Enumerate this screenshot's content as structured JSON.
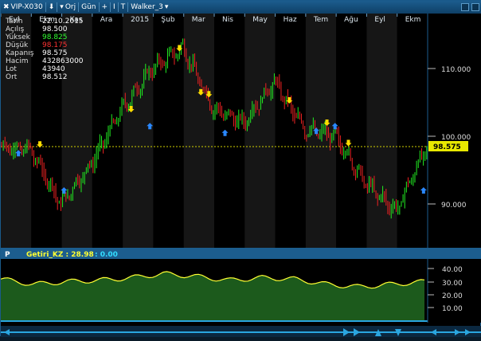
{
  "toolbar": {
    "symbol": "VIP-X030",
    "period_mode": "Orj",
    "interval": "Gün",
    "tool1": "I",
    "tool2": "T",
    "indicator_set": "Walker_3",
    "plus": "+"
  },
  "time_axis": [
    "Eyl",
    "Ekm",
    "Kas",
    "Ara",
    "2015",
    "Şub",
    "Mar",
    "Nis",
    "May",
    "Haz",
    "Tem",
    "Ağu",
    "Eyl",
    "Ekm"
  ],
  "info_panel": [
    {
      "label": "Tarih",
      "value": "22.10.2015",
      "color": "#ffffff"
    },
    {
      "label": "Açılış",
      "value": "98.500",
      "color": "#ffffff"
    },
    {
      "label": "Yüksek",
      "value": "98.825",
      "color": "#33ff33"
    },
    {
      "label": "Düşük",
      "value": "98.175",
      "color": "#ff3333"
    },
    {
      "label": "Kapanış",
      "value": "98.575",
      "color": "#ffffff"
    },
    {
      "label": "Hacim",
      "value": "432863000",
      "color": "#ffffff"
    },
    {
      "label": "Lot",
      "value": "43940",
      "color": "#ffffff"
    },
    {
      "label": "Ort",
      "value": "98.512",
      "color": "#ffffff"
    }
  ],
  "price_axis": {
    "ticks": [
      "110.000",
      "100.000",
      "90.000"
    ],
    "last_price": "98.575"
  },
  "indicator": {
    "pane_label": "P",
    "name": "Getiri_KZ : 28.98",
    "secondary": ": 0.00",
    "ticks": [
      "40.00",
      "30.00",
      "20.00",
      "10.00"
    ]
  },
  "colors": {
    "bull": "#22ee22",
    "bear": "#ee2222",
    "signal_down": "#ffdd00",
    "signal_up": "#2a88ff",
    "line": "#ffff33",
    "fill": "#1c5a1c",
    "accent": "#1c5d8e"
  },
  "chart_data": {
    "type": "line",
    "title": "VIP-X030",
    "price_series": [
      {
        "period": "Eyl",
        "close": 98.0
      },
      {
        "period": "Ekm",
        "close": 90.0
      },
      {
        "period": "Kas",
        "close": 96.0
      },
      {
        "period": "Ara",
        "close": 104.0
      },
      {
        "period": "2015",
        "close": 110.0
      },
      {
        "period": "Şub",
        "close": 113.0
      },
      {
        "period": "Mar",
        "close": 104.0
      },
      {
        "period": "Nis",
        "close": 102.0
      },
      {
        "period": "May",
        "close": 108.0
      },
      {
        "period": "Haz",
        "close": 101.0
      },
      {
        "period": "Tem",
        "close": 100.0
      },
      {
        "period": "Ağu",
        "close": 93.0
      },
      {
        "period": "Eyl",
        "close": 89.0
      },
      {
        "period": "Ekm",
        "close": 98.575
      }
    ],
    "price_ylim": [
      84,
      117
    ],
    "indicator_series": [
      32,
      28,
      30,
      31,
      33,
      36,
      34,
      31,
      33,
      32,
      28,
      26,
      28,
      30
    ],
    "indicator_ylim": [
      0,
      45
    ]
  }
}
